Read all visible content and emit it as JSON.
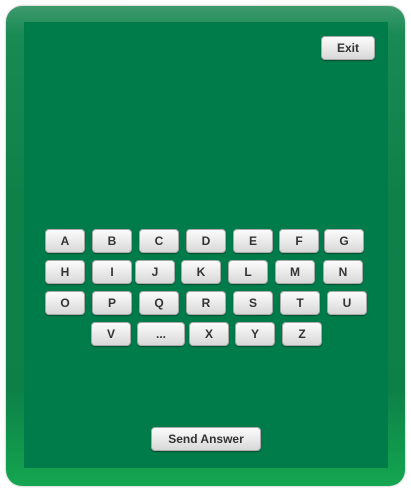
{
  "header": {
    "exit_label": "Exit"
  },
  "keyboard": {
    "rows": [
      [
        "A",
        "B",
        "C",
        "D",
        "E",
        "F",
        "G"
      ],
      [
        "H",
        "I",
        "J",
        "K",
        "L",
        "M",
        "N"
      ],
      [
        "O",
        "P",
        "Q",
        "R",
        "S",
        "T",
        "U"
      ],
      [
        "V",
        "...",
        "X",
        "Y",
        "Z"
      ]
    ]
  },
  "footer": {
    "send_label": "Send Answer"
  }
}
